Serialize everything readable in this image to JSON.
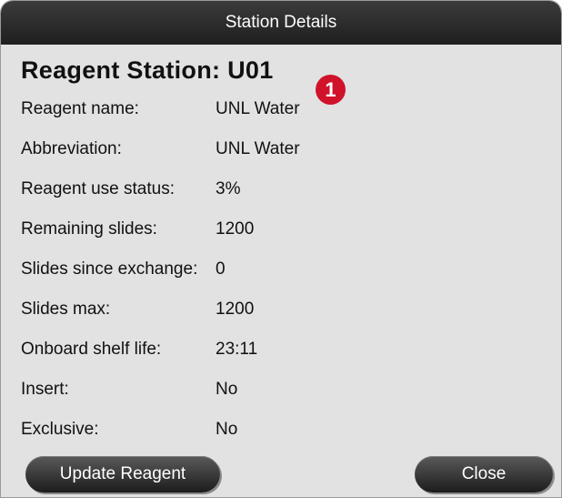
{
  "dialog": {
    "title": "Station Details",
    "heading": "Reagent Station: U01",
    "badge": "1"
  },
  "fields": [
    {
      "label": "Reagent name:",
      "value": "UNL Water"
    },
    {
      "label": "Abbreviation:",
      "value": "UNL Water"
    },
    {
      "label": "Reagent use status:",
      "value": "3%"
    },
    {
      "label": "Remaining slides:",
      "value": "1200"
    },
    {
      "label": "Slides since exchange:",
      "value": "0"
    },
    {
      "label": "Slides max:",
      "value": "1200"
    },
    {
      "label": "Onboard shelf life:",
      "value": "23:11"
    },
    {
      "label": "Insert:",
      "value": "No"
    },
    {
      "label": "Exclusive:",
      "value": "No"
    }
  ],
  "buttons": {
    "update_label": "Update Reagent",
    "close_label": "Close"
  },
  "colors": {
    "titlebar": "#2a2a2a",
    "background": "#e2e2e2",
    "badge": "#d0122a"
  }
}
